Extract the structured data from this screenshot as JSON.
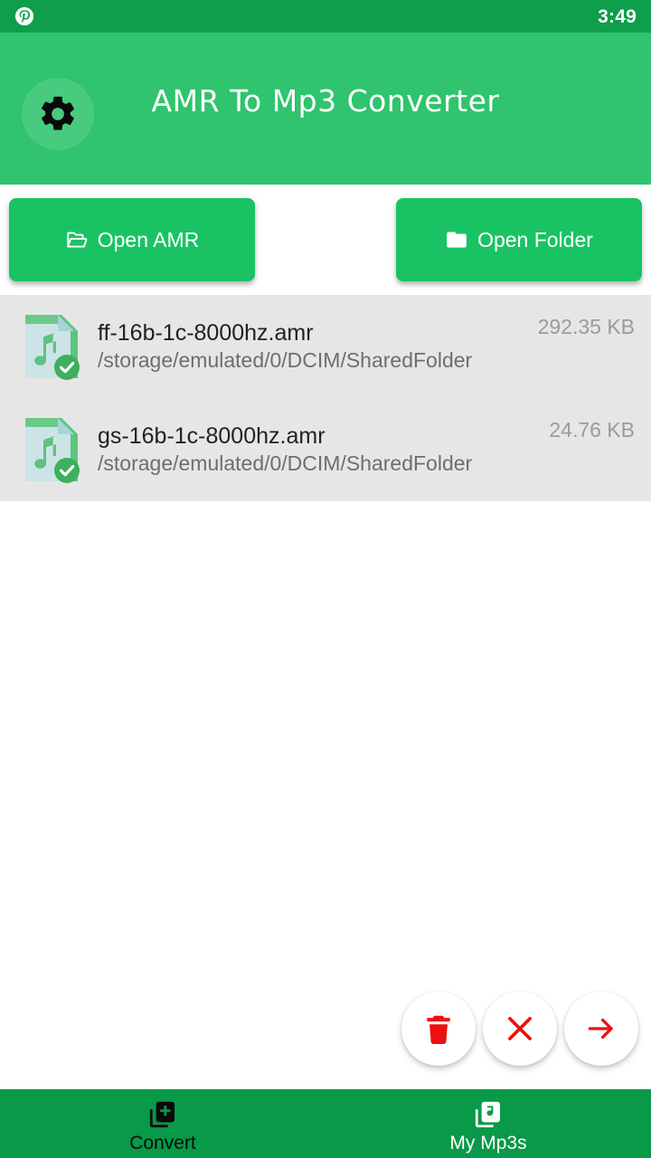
{
  "status_bar": {
    "app_icon": "pinterest-icon",
    "time": "3:49",
    "background": "#0F9E49"
  },
  "app_bar": {
    "title": "AMR To Mp3 Converter",
    "settings_icon": "gear-icon",
    "background": "#2FC46D",
    "title_color": "#FFFFFF"
  },
  "actions": {
    "open_amr": {
      "label": "Open AMR",
      "icon": "folder-open-icon"
    },
    "open_folder": {
      "label": "Open Folder",
      "icon": "folder-icon"
    },
    "button_color": "#19C364"
  },
  "file_list": {
    "background": "#E6E6E6",
    "items": [
      {
        "name": "ff-16b-1c-8000hz.amr",
        "path": "/storage/emulated/0/DCIM/SharedFolder",
        "size": "292.35 KB",
        "icon": "audio-file-icon",
        "selected": true,
        "badge": "check-circle-icon"
      },
      {
        "name": "gs-16b-1c-8000hz.amr",
        "path": "/storage/emulated/0/DCIM/SharedFolder",
        "size": "24.76 KB",
        "icon": "audio-file-icon",
        "selected": true,
        "badge": "check-circle-icon"
      }
    ]
  },
  "fabs": {
    "accent": "#EE1010",
    "buttons": [
      {
        "name": "delete",
        "icon": "trash-icon"
      },
      {
        "name": "clear",
        "icon": "close-x-icon"
      },
      {
        "name": "convert",
        "icon": "arrow-right-icon"
      }
    ]
  },
  "bottom_nav": {
    "background": "#089949",
    "items": [
      {
        "label": "Convert",
        "icon": "library-add-icon",
        "active": true
      },
      {
        "label": "My Mp3s",
        "icon": "library-music-icon",
        "active": false
      }
    ]
  }
}
